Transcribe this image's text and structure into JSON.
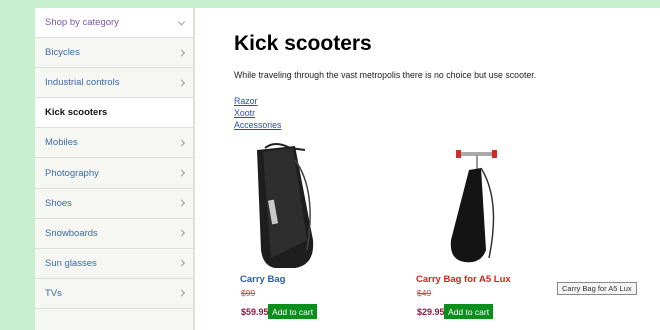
{
  "sidebar": {
    "header": "Shop by category",
    "items": [
      {
        "label": "Bicycles"
      },
      {
        "label": "Industrial controls"
      },
      {
        "label": "Kick scooters"
      },
      {
        "label": "Mobiles"
      },
      {
        "label": "Photography"
      },
      {
        "label": "Shoes"
      },
      {
        "label": "Snowboards"
      },
      {
        "label": "Sun glasses"
      },
      {
        "label": "TVs"
      }
    ]
  },
  "main": {
    "title": "Kick scooters",
    "description": "While traveling through the vast metropolis there is no choice but use scooter.",
    "links": [
      "Razor",
      "Xootr",
      "Accessories"
    ],
    "products": [
      {
        "name": "Carry Bag",
        "old_price": "$99",
        "price": "$59.95",
        "button": "Add to cart",
        "name_color": "#2a5caa"
      },
      {
        "name": "Carry Bag for A5 Lux",
        "old_price": "$49",
        "price": "$29.95",
        "button": "Add to cart",
        "name_color": "#d4241c"
      }
    ]
  },
  "tooltip": "Carry Bag for A5 Lux"
}
